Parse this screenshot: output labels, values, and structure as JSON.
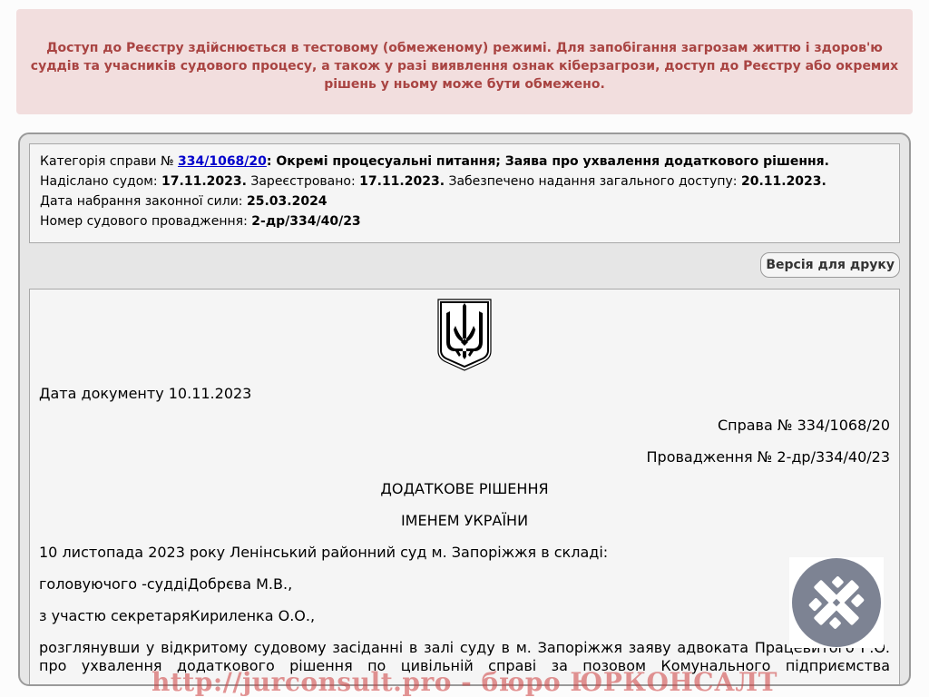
{
  "alert": {
    "text": "Доступ до Реєстру здійснюється в тестовому (обмеженому) режимі. Для запобігання загрозам життю і здоров'ю суддів та учасників судового процесу, а також у разі виявлення ознак кіберзагрози, доступ до Реєстру або окремих рішень у ньому може бути обмежено."
  },
  "info": {
    "category_label": "Категорія справи №",
    "case_link": "334/1068/20",
    "category_value": ": Окремі процесуальні питання; Заява про ухвалення додаткового рішення.",
    "sent_label": "Надіслано судом:",
    "sent_value": "17.11.2023.",
    "registered_label": "Зареєстровано:",
    "registered_value": "17.11.2023.",
    "public_label": "Забезпечено надання загального доступу:",
    "public_value": "20.11.2023.",
    "effective_label": "Дата набрання законної сили:",
    "effective_value": "25.03.2024",
    "proceeding_label": "Номер судового провадження:",
    "proceeding_value": "2-др/334/40/23"
  },
  "print_button": "Версія для друку",
  "document": {
    "date": "Дата документу 10.11.2023",
    "case_no": "Справа № 334/1068/20",
    "proceeding_no": "Провадження № 2-др/334/40/23",
    "title": "ДОДАТКОВЕ РІШЕННЯ",
    "subtitle": "ІМЕНЕМ УКРАЇНИ",
    "p1": "10 листопада 2023 року Ленінський районний суд м. Запоріжжя в складі:",
    "p2": "головуючого -суддіДобрєва М.В.,",
    "p3": "з участю секретаряКириленка О.О.,",
    "p4_line1": "розглянувши у відкритому судовому засіданні в залі суду в м. Запоріжжя заяву адвоката Працевитого Г.О.",
    "p4_line2": "про ухвалення додаткового рішення по цивільній справі за позовом Комунального підприємства"
  },
  "watermark": {
    "url_text": "http://jurconsult.pro - бюро ЮРКОНСАЛТ",
    "logo_color": "#7d8393"
  },
  "colors": {
    "alert_bg": "#f2dede",
    "alert_text": "#a94442",
    "link": "#0000cc"
  }
}
